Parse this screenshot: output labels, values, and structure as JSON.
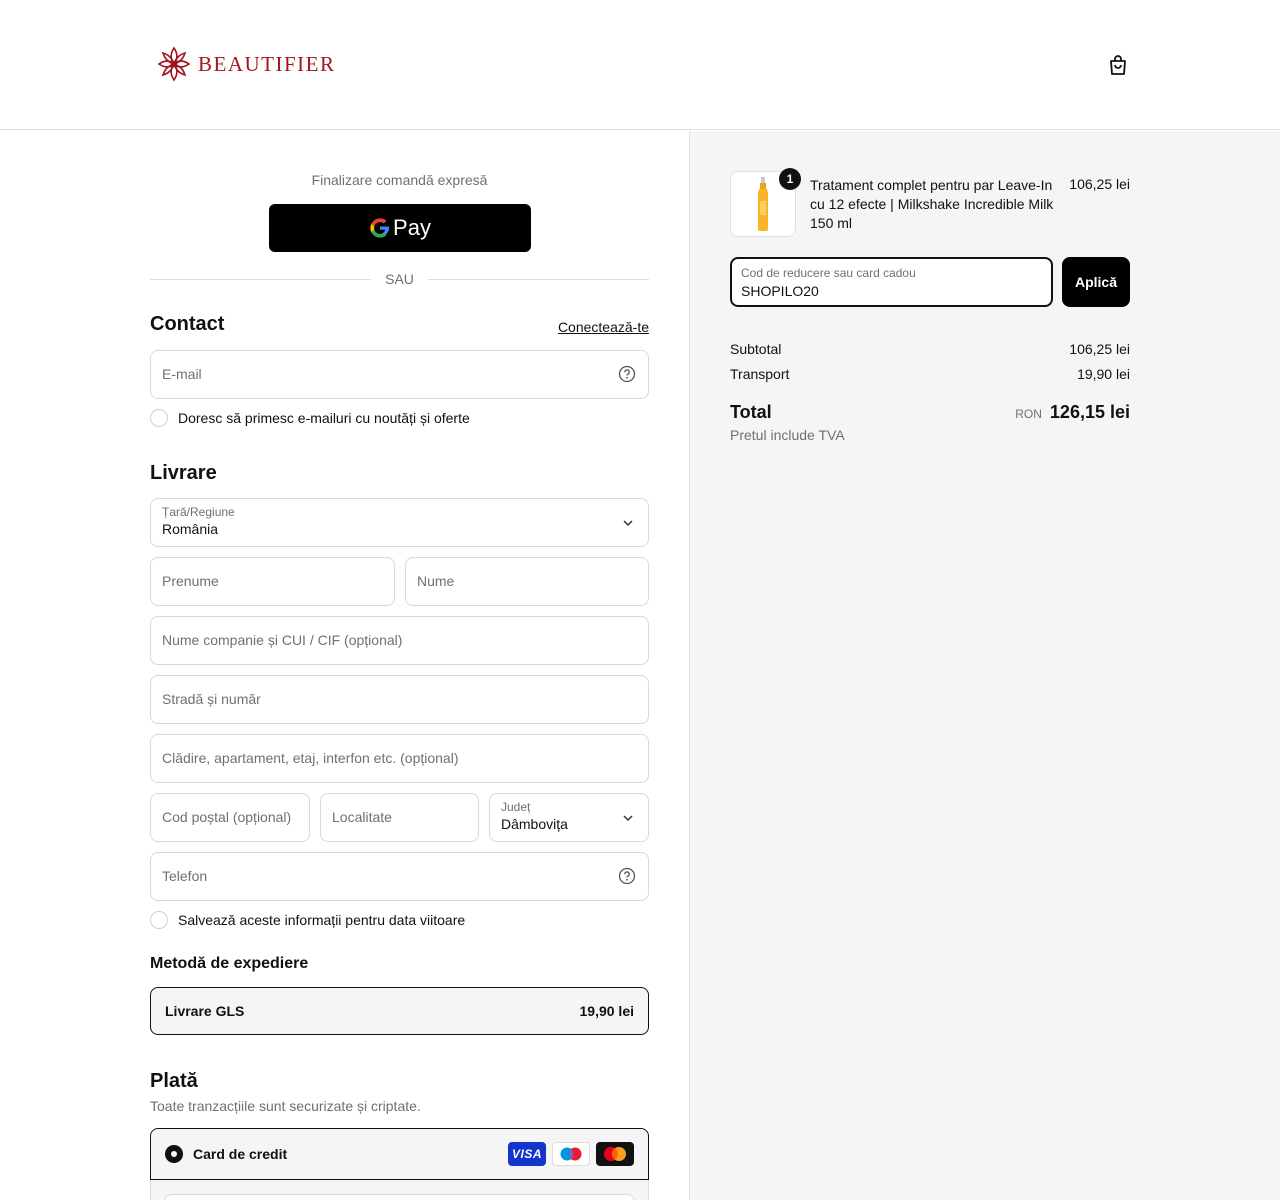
{
  "header": {
    "brand": "BEAUTIFIER",
    "brand_color": "#a3151b"
  },
  "express": {
    "title": "Finalizare comandă expresă",
    "gpay_label": "Pay",
    "or": "SAU"
  },
  "contact": {
    "title": "Contact",
    "login_link": "Conectează-te",
    "email_placeholder": "E-mail",
    "newsletter_label": "Doresc să primesc e-mailuri cu noutăți și oferte"
  },
  "delivery": {
    "title": "Livrare",
    "country_label": "Țară/Regiune",
    "country_value": "România",
    "first_name_placeholder": "Prenume",
    "last_name_placeholder": "Nume",
    "company_placeholder": "Nume companie și CUI / CIF (opțional)",
    "street_placeholder": "Stradă și număr",
    "building_placeholder": "Clădire, apartament, etaj, interfon etc. (opțional)",
    "postal_placeholder": "Cod poștal (opțional)",
    "city_placeholder": "Localitate",
    "county_label": "Județ",
    "county_value": "Dâmbovița",
    "phone_placeholder": "Telefon",
    "save_info_label": "Salvează aceste informații pentru data viitoare"
  },
  "shipping": {
    "title": "Metodă de expediere",
    "method": "Livrare GLS",
    "price": "19,90 lei"
  },
  "payment": {
    "title": "Plată",
    "subtitle": "Toate tranzacțiile sunt securizate și criptate.",
    "method_label": "Card de credit",
    "cards": [
      "VISA",
      "maestro-icon",
      "mastercard-icon"
    ]
  },
  "summary": {
    "product": {
      "qty": "1",
      "name": "Tratament complet pentru par Leave-In cu 12 efecte | Milkshake Incredible Milk 150 ml",
      "price": "106,25 lei"
    },
    "discount_label": "Cod de reducere sau card cadou",
    "discount_value": "SHOPILO20",
    "apply_label": "Aplică",
    "subtotal_label": "Subtotal",
    "subtotal_value": "106,25 lei",
    "transport_label": "Transport",
    "transport_value": "19,90 lei",
    "total_label": "Total",
    "currency": "RON",
    "total_value": "126,15 lei",
    "vat_note": "Pretul include TVA"
  }
}
